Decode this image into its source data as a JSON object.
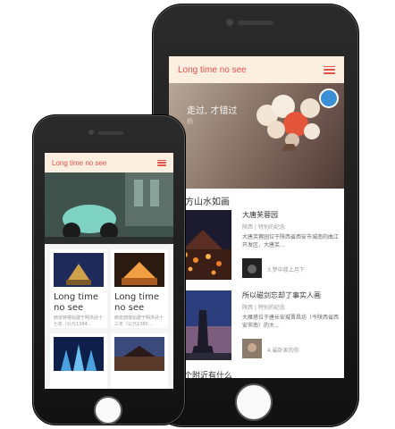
{
  "colors": {
    "accent": "#e2504a",
    "appbar_bg": "#fcefe0",
    "phone_body": "#1a1a1a"
  },
  "large_phone": {
    "appbar": {
      "title": "Long time no see",
      "menu_icon": "hamburger-menu-icon"
    },
    "hero": {
      "caption": "走过, 才错过",
      "sub": "杨"
    },
    "section": {
      "title": "一方山水如画",
      "items": [
        {
          "title": "大唐芙蓉园",
          "tags": "陕西 | 特别的纪念",
          "desc": "大唐芙蓉园位于陕西省西安市城南的曲江开发区，大唐芙...",
          "mini_label": "3.梦中楼上月下"
        },
        {
          "title": "所以磁剑忘却了事实人画",
          "tags": "陕西 | 特别的纪念",
          "desc": "大雁塔位于唐长安城晋昌坊（今陕西省西安市南）的大...",
          "mini_label": "4.最卧家的你"
        }
      ],
      "footer_partial": "一个附近有什么"
    }
  },
  "small_phone": {
    "appbar": {
      "title": "Long time no see",
      "menu_icon": "hamburger-menu-icon"
    },
    "cards": [
      {
        "title": "Long time no see",
        "desc": "西安钟楼始建于明洪武十七年（公元1384..."
      },
      {
        "title": "Long time no see",
        "desc": "西安鼓楼始建于明洪武十三年（公元1380..."
      },
      {
        "title": "",
        "desc": ""
      },
      {
        "title": "",
        "desc": ""
      }
    ]
  }
}
